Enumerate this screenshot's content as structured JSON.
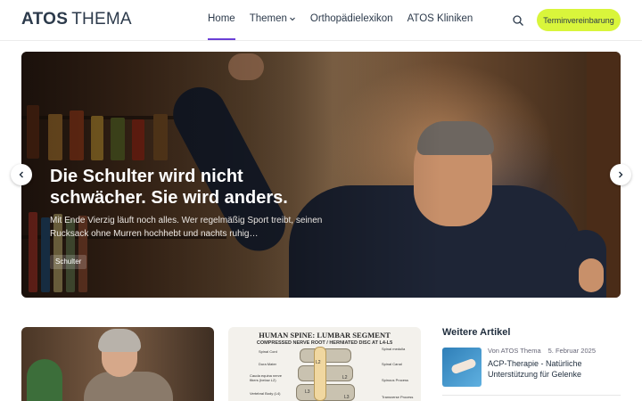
{
  "header": {
    "logo_brand": "ATOS",
    "logo_word": "THEMA",
    "nav": [
      {
        "label": "Home"
      },
      {
        "label": "Themen"
      },
      {
        "label": "Orthopädielexikon"
      },
      {
        "label": "ATOS Kliniken"
      }
    ],
    "cta_label": "Terminvereinbarung"
  },
  "hero": {
    "title": "Die Schulter wird nicht schwächer. Sie wird anders.",
    "excerpt": "Mit Ende Vierzig läuft noch alles. Wer regelmäßig Sport treibt, seinen Rucksack ohne Murren hochhebt und nachts ruhig…",
    "tag": "Schulter",
    "slides_total": 3,
    "slide_active": 1
  },
  "cards": {
    "diagram": {
      "title": "HUMAN SPINE: LUMBAR SEGMENT",
      "subtitle": "COMPRESSED NERVE ROOT / HERNIATED DISC AT L4-L5",
      "labels_left": [
        "Spinal Cord",
        "Dura Mater",
        "Cauda equina nerve fibers (below L2)",
        "Vertebral Body (L4)"
      ],
      "labels_right": [
        "Spinal medulla",
        "Spinal Canal",
        "Spinous Process",
        "Transverse Process"
      ],
      "vertebrae": [
        "L2",
        "L2",
        "L3",
        "L3"
      ]
    }
  },
  "sidebar": {
    "title": "Weitere Artikel",
    "items": [
      {
        "author": "Von ATOS Thema",
        "date": "5. Februar 2025",
        "headline": "ACP-Therapie - Natürliche Unterstützung für Gelenke"
      }
    ]
  },
  "colors": {
    "accent": "#6a3fd6",
    "cta_bg": "#d9f53b",
    "text": "#1f2d3d"
  }
}
